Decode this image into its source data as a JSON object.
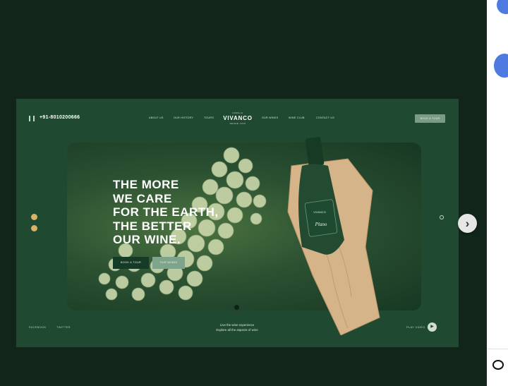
{
  "site": {
    "phone": "+91-8010200666",
    "brand_top": "FAMILIA",
    "brand": "VIVANCO",
    "brand_sub": "DESDE 1915",
    "nav_links": [
      "ABOUT US",
      "OUR HISTORY",
      "TOURS",
      "OUR WINES",
      "WINE CLUB",
      "CONTACT US"
    ],
    "book_label": "BOOK A TOUR"
  },
  "hero": {
    "headline_lines": [
      "THE MORE",
      "WE CARE",
      "FOR THE EARTH,",
      "THE BETTER",
      "OUR WINE."
    ],
    "cta_primary": "BOOK A TOUR",
    "cta_secondary": "OUR WINES",
    "bottle_label_top": "VIVANCO",
    "bottle_label_name": "Plano"
  },
  "footer": {
    "facebook": "FACEBOOK",
    "twitter": "TWITTER",
    "tagline_line1": "Live the wine experience",
    "tagline_line2": "Explore all the aspects of wine",
    "play_label": "PLAY VIDEO",
    "play_symbol": "▶"
  },
  "carousel": {
    "next_symbol": "›"
  },
  "colors": {
    "page_bg": "#12251b",
    "shot_bg": "#1f4a31",
    "accent_gold": "#d7b268",
    "button_sage": "#7a9b85"
  }
}
